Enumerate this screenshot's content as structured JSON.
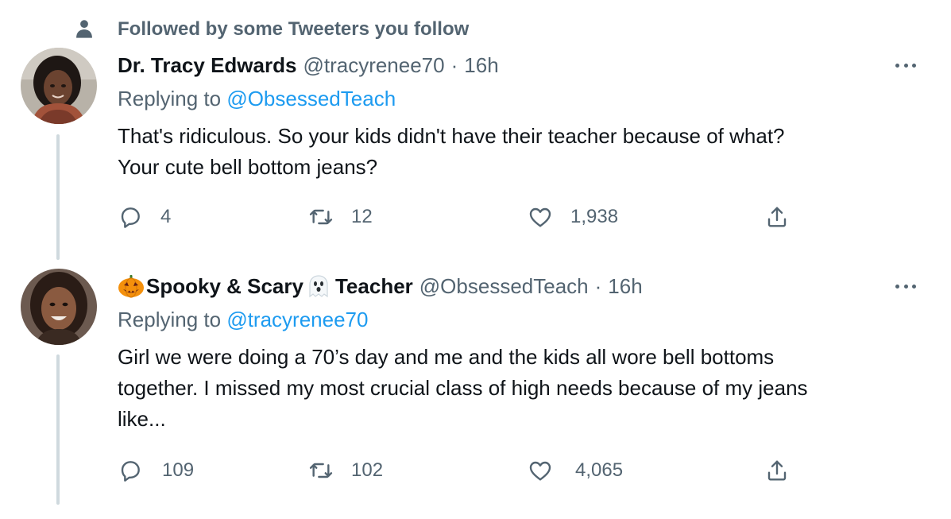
{
  "social_context": {
    "text": "Followed by some Tweeters you follow",
    "icon": "person-icon"
  },
  "tweets": [
    {
      "display_name": "Dr. Tracy Edwards",
      "handle": "@tracyrenee70",
      "separator": "·",
      "time": "16h",
      "replying_prefix": "Replying to ",
      "replying_to": "@ObsessedTeach",
      "text": "That's ridiculous. So your kids didn't have their teacher because of what?\nYour cute bell bottom jeans?",
      "replies": "4",
      "retweets": "12",
      "likes": "1,938"
    },
    {
      "display_name_prefix_emoji": "jack-o-lantern-icon",
      "display_name_part1": "Spooky & Scary",
      "display_name_mid_emoji": "ghost-icon",
      "display_name_part2": "Teacher",
      "handle": "@ObsessedTeach",
      "separator": "·",
      "time": "16h",
      "replying_prefix": "Replying to ",
      "replying_to": "@tracyrenee70",
      "text": "Girl we were doing a 70’s day and me and the kids all wore bell bottoms\ntogether. I missed my most crucial class of high needs because of my jeans\nlike...",
      "replies": "109",
      "retweets": "102",
      "likes": "4,065"
    }
  ],
  "colors": {
    "text_primary": "#0f1419",
    "text_secondary": "#536471",
    "link": "#1d9bf0",
    "thread_line": "#cfd9de"
  }
}
